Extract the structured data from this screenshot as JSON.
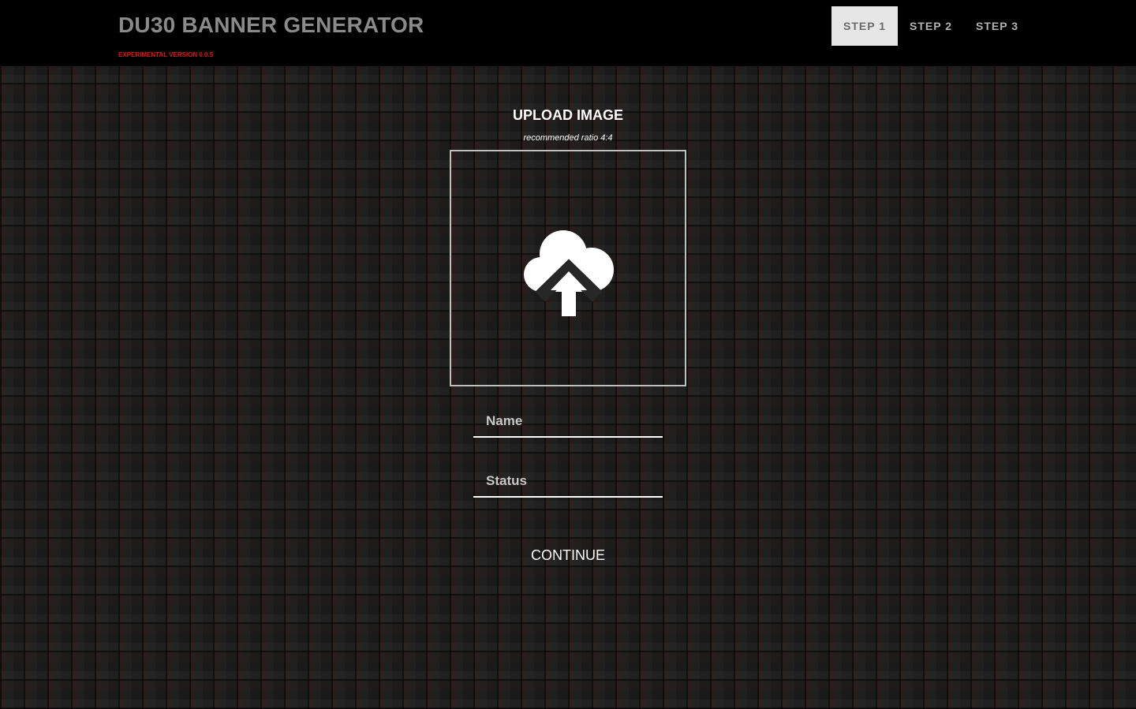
{
  "header": {
    "title": "DU30 BANNER GENERATOR",
    "version": "EXPERIMENTAL VERSION 0.0.5",
    "steps": [
      {
        "label": "STEP 1",
        "active": true
      },
      {
        "label": "STEP 2",
        "active": false
      },
      {
        "label": "STEP 3",
        "active": false
      }
    ]
  },
  "upload": {
    "title": "UPLOAD IMAGE",
    "hint": "recommended ratio 4:4",
    "icon": "cloud-upload-icon"
  },
  "form": {
    "name_placeholder": "Name",
    "status_placeholder": "Status",
    "continue_label": "CONTINUE"
  },
  "colors": {
    "header_bg": "#000000",
    "title": "#8a8a8a",
    "version": "#e01818",
    "active_step_bg": "#e6e6e6",
    "text": "#ffffff"
  }
}
